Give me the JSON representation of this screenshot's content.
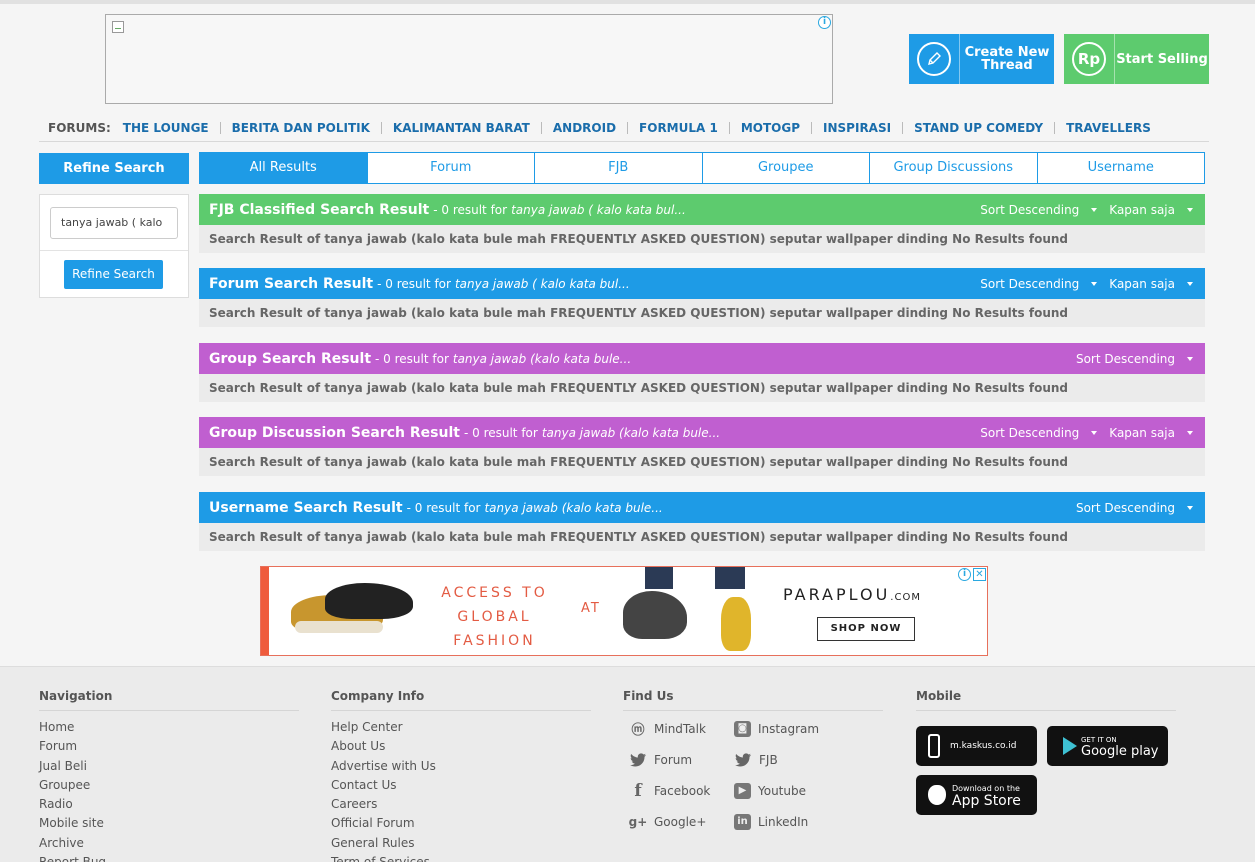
{
  "header": {
    "create_thread_label": "Create New Thread",
    "start_selling_label": "Start Selling",
    "sell_icon_text": "Rp"
  },
  "forums": {
    "label": "FORUMS:",
    "items": [
      "THE LOUNGE",
      "BERITA DAN POLITIK",
      "KALIMANTAN BARAT",
      "ANDROID",
      "FORMULA 1",
      "MOTOGP",
      "INSPIRASI",
      "STAND UP COMEDY",
      "TRAVELLERS"
    ]
  },
  "refine": {
    "title": "Refine Search",
    "input_value": "tanya jawab ( kalo",
    "button_label": "Refine Search"
  },
  "tabs": [
    "All Results",
    "Forum",
    "FJB",
    "Groupee",
    "Group Discussions",
    "Username"
  ],
  "sections": [
    {
      "title": "FJB Classified Search Result",
      "count": "- 0 result for",
      "query": "tanya jawab ( kalo kata bul...",
      "sort": "Sort Descending",
      "time": "Kapan saja",
      "color": "#5dcb6e",
      "body": "Search Result of tanya jawab (kalo kata bule mah FREQUENTLY ASKED QUESTION) seputar wallpaper dinding No Results found"
    },
    {
      "title": "Forum Search Result",
      "count": "- 0 result for",
      "query": "tanya jawab ( kalo kata bul...",
      "sort": "Sort Descending",
      "time": "Kapan saja",
      "color": "#1e9be6",
      "body": "Search Result of tanya jawab (kalo kata bule mah FREQUENTLY ASKED QUESTION) seputar wallpaper dinding No Results found"
    },
    {
      "title": "Group Search Result",
      "count": "- 0 result for",
      "query": "tanya jawab (kalo kata bule...",
      "sort": "Sort Descending",
      "time": "",
      "color": "#c05fd0",
      "body": "Search Result of tanya jawab (kalo kata bule mah FREQUENTLY ASKED QUESTION) seputar wallpaper dinding No Results found"
    },
    {
      "title": "Group Discussion Search Result",
      "count": "- 0 result for",
      "query": "tanya jawab (kalo kata bule...",
      "sort": "Sort Descending",
      "time": "Kapan saja",
      "color": "#c05fd0",
      "body": "Search Result of tanya jawab (kalo kata bule mah FREQUENTLY ASKED QUESTION) seputar wallpaper dinding No Results found"
    },
    {
      "title": "Username Search Result",
      "count": "- 0 result for",
      "query": "tanya jawab (kalo kata bule...",
      "sort": "Sort Descending",
      "time": "",
      "color": "#1e9be6",
      "body": "Search Result of tanya jawab (kalo kata bule mah FREQUENTLY ASKED QUESTION) seputar wallpaper dinding No Results found"
    }
  ],
  "ad": {
    "tagline_1": "ACCESS TO",
    "tagline_2": "GLOBAL",
    "tagline_3": "FASHION",
    "at": "AT",
    "brand": "PARAPLOU",
    "brand_suffix": ".COM",
    "cta": "SHOP NOW"
  },
  "footer": {
    "navigation": {
      "title": "Navigation",
      "links": [
        "Home",
        "Forum",
        "Jual Beli",
        "Groupee",
        "Radio",
        "Mobile site",
        "Archive",
        "Report Bug"
      ]
    },
    "company": {
      "title": "Company Info",
      "links": [
        "Help Center",
        "About Us",
        "Advertise with Us",
        "Contact Us",
        "Careers",
        "Official Forum",
        "General Rules",
        "Term of Services"
      ]
    },
    "find_us": {
      "title": "Find Us",
      "items": [
        {
          "label": "MindTalk",
          "icon": "mindtalk-icon"
        },
        {
          "label": "Instagram",
          "icon": "instagram-icon"
        },
        {
          "label": "Forum",
          "icon": "twitter-icon"
        },
        {
          "label": "FJB",
          "icon": "twitter-icon"
        },
        {
          "label": "Facebook",
          "icon": "facebook-icon"
        },
        {
          "label": "Youtube",
          "icon": "youtube-icon"
        },
        {
          "label": "Google+",
          "icon": "google-plus-icon"
        },
        {
          "label": "LinkedIn",
          "icon": "linkedin-icon"
        }
      ]
    },
    "mobile": {
      "title": "Mobile",
      "mobile_site": "m.kaskus.co.id",
      "google_small": "GET IT ON",
      "google_big": "Google play",
      "apple_small": "Download on the",
      "apple_big": "App Store"
    }
  }
}
